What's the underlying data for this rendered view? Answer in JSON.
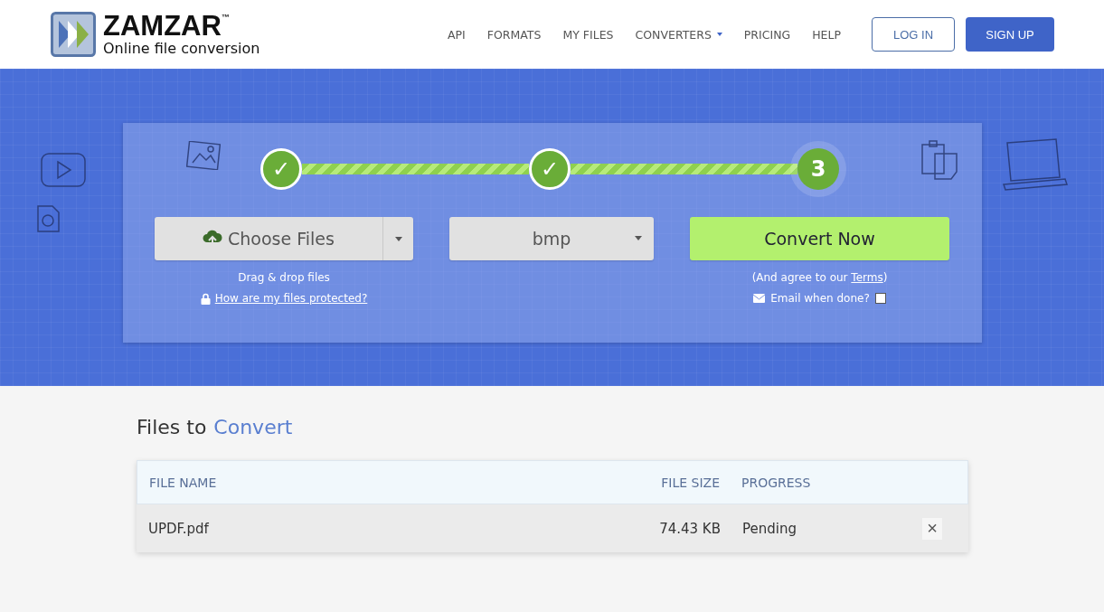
{
  "header": {
    "logo": {
      "name": "ZAMZAR",
      "trademark": "™",
      "tagline": "Online file conversion"
    },
    "nav": [
      {
        "label": "API",
        "dropdown": false
      },
      {
        "label": "FORMATS",
        "dropdown": false
      },
      {
        "label": "MY FILES",
        "dropdown": false
      },
      {
        "label": "CONVERTERS",
        "dropdown": true
      },
      {
        "label": "PRICING",
        "dropdown": false
      },
      {
        "label": "HELP",
        "dropdown": false
      }
    ],
    "login": "LOG IN",
    "signup": "SIGN UP"
  },
  "steps": [
    {
      "kind": "done",
      "label": "✓"
    },
    {
      "kind": "done",
      "label": "✓"
    },
    {
      "kind": "current",
      "label": "3"
    }
  ],
  "connectors": [
    {
      "level": 1
    },
    {
      "level": 1
    }
  ],
  "upload": {
    "button": "Choose Files",
    "hint": "Drag & drop files",
    "link": "How are my files protected?"
  },
  "format": {
    "value": "bmp"
  },
  "convert": {
    "button": "Convert Now",
    "agree_before": "(And agree to our ",
    "agree_link": "Terms",
    "agree_after": ")",
    "email_label": "Email when done?",
    "email_checked": false
  },
  "files": {
    "title_start": "Files to",
    "title_accent": "Convert",
    "columns": [
      "FILE NAME",
      "FILE SIZE",
      "PROGRESS"
    ],
    "rows": [
      {
        "name": "UPDF.pdf",
        "size": "74.43 KB",
        "progress": "Pending",
        "remove": "×"
      }
    ]
  }
}
